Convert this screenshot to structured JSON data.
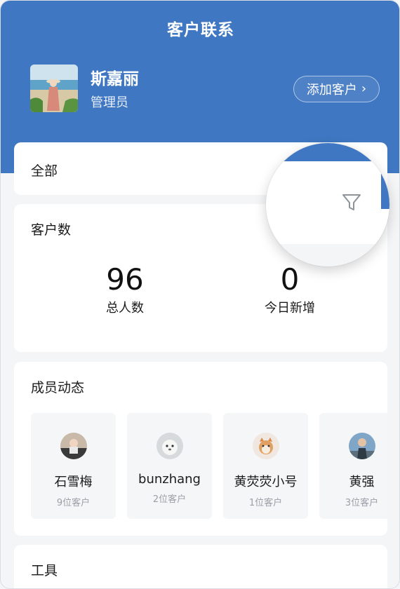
{
  "app": {
    "title": "客户联系"
  },
  "user": {
    "name": "斯嘉丽",
    "role": "管理员"
  },
  "header": {
    "add_customer_label": "添加客户",
    "add_chevron": "›"
  },
  "filter": {
    "label": "全部",
    "icon": "filter-icon"
  },
  "customer_count": {
    "title": "客户数",
    "total": {
      "value": "96",
      "label": "总人数"
    },
    "today": {
      "value": "0",
      "label": "今日新增"
    }
  },
  "members": {
    "title": "成员动态",
    "items": [
      {
        "name": "石雪梅",
        "count": "9位客户"
      },
      {
        "name": "bunzhang",
        "count": "2位客户"
      },
      {
        "name": "黄荧荧小号",
        "count": "1位客户"
      },
      {
        "name": "黄强",
        "count": "3位客户"
      }
    ]
  },
  "tools": {
    "title": "工具"
  },
  "colors": {
    "primary": "#3f77c2",
    "background": "#f4f5f7"
  }
}
